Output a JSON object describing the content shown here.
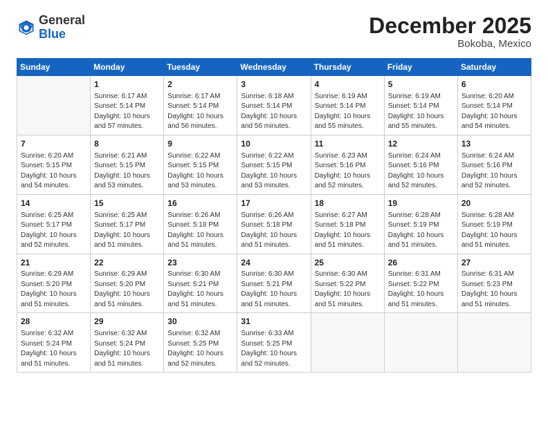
{
  "header": {
    "logo_general": "General",
    "logo_blue": "Blue",
    "month_title": "December 2025",
    "location": "Bokoba, Mexico"
  },
  "days_of_week": [
    "Sunday",
    "Monday",
    "Tuesday",
    "Wednesday",
    "Thursday",
    "Friday",
    "Saturday"
  ],
  "weeks": [
    [
      {
        "day": "",
        "info": ""
      },
      {
        "day": "1",
        "info": "Sunrise: 6:17 AM\nSunset: 5:14 PM\nDaylight: 10 hours\nand 57 minutes."
      },
      {
        "day": "2",
        "info": "Sunrise: 6:17 AM\nSunset: 5:14 PM\nDaylight: 10 hours\nand 56 minutes."
      },
      {
        "day": "3",
        "info": "Sunrise: 6:18 AM\nSunset: 5:14 PM\nDaylight: 10 hours\nand 56 minutes."
      },
      {
        "day": "4",
        "info": "Sunrise: 6:19 AM\nSunset: 5:14 PM\nDaylight: 10 hours\nand 55 minutes."
      },
      {
        "day": "5",
        "info": "Sunrise: 6:19 AM\nSunset: 5:14 PM\nDaylight: 10 hours\nand 55 minutes."
      },
      {
        "day": "6",
        "info": "Sunrise: 6:20 AM\nSunset: 5:14 PM\nDaylight: 10 hours\nand 54 minutes."
      }
    ],
    [
      {
        "day": "7",
        "info": "Sunrise: 6:20 AM\nSunset: 5:15 PM\nDaylight: 10 hours\nand 54 minutes."
      },
      {
        "day": "8",
        "info": "Sunrise: 6:21 AM\nSunset: 5:15 PM\nDaylight: 10 hours\nand 53 minutes."
      },
      {
        "day": "9",
        "info": "Sunrise: 6:22 AM\nSunset: 5:15 PM\nDaylight: 10 hours\nand 53 minutes."
      },
      {
        "day": "10",
        "info": "Sunrise: 6:22 AM\nSunset: 5:15 PM\nDaylight: 10 hours\nand 53 minutes."
      },
      {
        "day": "11",
        "info": "Sunrise: 6:23 AM\nSunset: 5:16 PM\nDaylight: 10 hours\nand 52 minutes."
      },
      {
        "day": "12",
        "info": "Sunrise: 6:24 AM\nSunset: 5:16 PM\nDaylight: 10 hours\nand 52 minutes."
      },
      {
        "day": "13",
        "info": "Sunrise: 6:24 AM\nSunset: 5:16 PM\nDaylight: 10 hours\nand 52 minutes."
      }
    ],
    [
      {
        "day": "14",
        "info": "Sunrise: 6:25 AM\nSunset: 5:17 PM\nDaylight: 10 hours\nand 52 minutes."
      },
      {
        "day": "15",
        "info": "Sunrise: 6:25 AM\nSunset: 5:17 PM\nDaylight: 10 hours\nand 51 minutes."
      },
      {
        "day": "16",
        "info": "Sunrise: 6:26 AM\nSunset: 5:18 PM\nDaylight: 10 hours\nand 51 minutes."
      },
      {
        "day": "17",
        "info": "Sunrise: 6:26 AM\nSunset: 5:18 PM\nDaylight: 10 hours\nand 51 minutes."
      },
      {
        "day": "18",
        "info": "Sunrise: 6:27 AM\nSunset: 5:18 PM\nDaylight: 10 hours\nand 51 minutes."
      },
      {
        "day": "19",
        "info": "Sunrise: 6:28 AM\nSunset: 5:19 PM\nDaylight: 10 hours\nand 51 minutes."
      },
      {
        "day": "20",
        "info": "Sunrise: 6:28 AM\nSunset: 5:19 PM\nDaylight: 10 hours\nand 51 minutes."
      }
    ],
    [
      {
        "day": "21",
        "info": "Sunrise: 6:29 AM\nSunset: 5:20 PM\nDaylight: 10 hours\nand 51 minutes."
      },
      {
        "day": "22",
        "info": "Sunrise: 6:29 AM\nSunset: 5:20 PM\nDaylight: 10 hours\nand 51 minutes."
      },
      {
        "day": "23",
        "info": "Sunrise: 6:30 AM\nSunset: 5:21 PM\nDaylight: 10 hours\nand 51 minutes."
      },
      {
        "day": "24",
        "info": "Sunrise: 6:30 AM\nSunset: 5:21 PM\nDaylight: 10 hours\nand 51 minutes."
      },
      {
        "day": "25",
        "info": "Sunrise: 6:30 AM\nSunset: 5:22 PM\nDaylight: 10 hours\nand 51 minutes."
      },
      {
        "day": "26",
        "info": "Sunrise: 6:31 AM\nSunset: 5:22 PM\nDaylight: 10 hours\nand 51 minutes."
      },
      {
        "day": "27",
        "info": "Sunrise: 6:31 AM\nSunset: 5:23 PM\nDaylight: 10 hours\nand 51 minutes."
      }
    ],
    [
      {
        "day": "28",
        "info": "Sunrise: 6:32 AM\nSunset: 5:24 PM\nDaylight: 10 hours\nand 51 minutes."
      },
      {
        "day": "29",
        "info": "Sunrise: 6:32 AM\nSunset: 5:24 PM\nDaylight: 10 hours\nand 51 minutes."
      },
      {
        "day": "30",
        "info": "Sunrise: 6:32 AM\nSunset: 5:25 PM\nDaylight: 10 hours\nand 52 minutes."
      },
      {
        "day": "31",
        "info": "Sunrise: 6:33 AM\nSunset: 5:25 PM\nDaylight: 10 hours\nand 52 minutes."
      },
      {
        "day": "",
        "info": ""
      },
      {
        "day": "",
        "info": ""
      },
      {
        "day": "",
        "info": ""
      }
    ]
  ]
}
